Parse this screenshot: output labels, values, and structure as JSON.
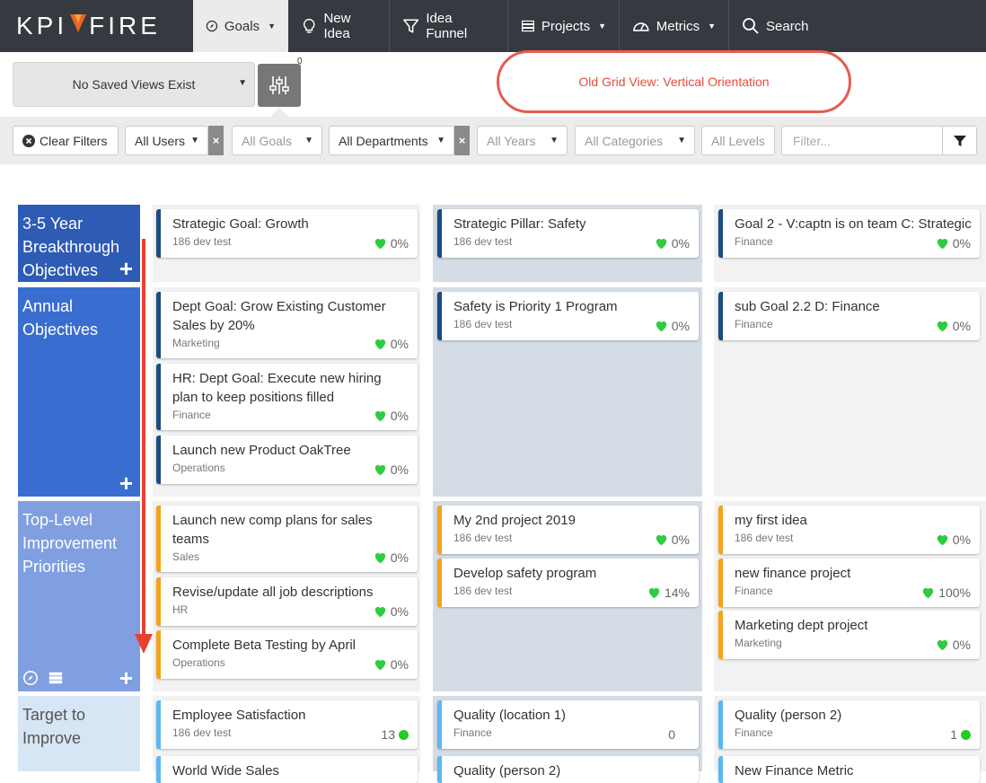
{
  "nav": {
    "logo_left": "KPI",
    "logo_right": "FIRE",
    "items": [
      {
        "label": "Goals",
        "icon": "compass-icon",
        "active": true,
        "dropdown": true
      },
      {
        "label": "New Idea",
        "icon": "lightbulb-icon",
        "active": false,
        "dropdown": false
      },
      {
        "label": "Idea Funnel",
        "icon": "funnel-icon",
        "active": false,
        "dropdown": false
      },
      {
        "label": "Projects",
        "icon": "server-icon",
        "active": false,
        "dropdown": true
      },
      {
        "label": "Metrics",
        "icon": "gauge-icon",
        "active": false,
        "dropdown": true
      },
      {
        "label": "Search",
        "icon": "search-icon",
        "active": false,
        "dropdown": false
      }
    ]
  },
  "toolbar": {
    "saved_views": "No Saved Views Exist",
    "settings_count": "0",
    "annotation": "Old Grid View:  Vertical Orientation"
  },
  "filters": {
    "clear": "Clear Filters",
    "users": "All Users",
    "goals": "All Goals",
    "departments": "All Departments",
    "years": "All Years",
    "categories": "All Categories",
    "levels": "All Levels",
    "filter_placeholder": "Filter..."
  },
  "rows": [
    {
      "label": "3-5 Year Breakthrough Objectives",
      "color": "#2e5bb4"
    },
    {
      "label": "Annual Objectives",
      "color": "#3a6dd0"
    },
    {
      "label": "Top-Level Improvement Priorities",
      "color": "#7f9fe0"
    },
    {
      "label": "Target to Improve",
      "color": "#d6e6f5"
    }
  ],
  "cards": {
    "r0c0": [
      {
        "title": "Strategic Goal: Growth",
        "sub": "186 dev test",
        "metric": "0%"
      }
    ],
    "r0c1": [
      {
        "title": "Strategic Pillar: Safety",
        "sub": "186 dev test",
        "metric": "0%"
      }
    ],
    "r0c2": [
      {
        "title": "Goal 2 - V:captn is on team C: Strategic",
        "sub": "Finance",
        "metric": "0%"
      }
    ],
    "r1c0": [
      {
        "title": "Dept Goal: Grow Existing Customer Sales by 20%",
        "sub": "Marketing",
        "metric": "0%"
      },
      {
        "title": "HR: Dept Goal: Execute new hiring plan to keep positions filled",
        "sub": "Finance",
        "metric": "0%"
      },
      {
        "title": "Launch new Product OakTree",
        "sub": "Operations",
        "metric": "0%"
      }
    ],
    "r1c1": [
      {
        "title": "Safety is Priority 1 Program",
        "sub": "186 dev test",
        "metric": "0%"
      }
    ],
    "r1c2": [
      {
        "title": "sub Goal 2.2 D: Finance",
        "sub": "Finance",
        "metric": "0%"
      }
    ],
    "r2c0": [
      {
        "title": "Launch new comp plans for sales teams",
        "sub": "Sales",
        "metric": "0%"
      },
      {
        "title": "Revise/update all job descriptions",
        "sub": "HR",
        "metric": "0%"
      },
      {
        "title": "Complete Beta Testing by April",
        "sub": "Operations",
        "metric": "0%"
      }
    ],
    "r2c1": [
      {
        "title": "My 2nd project 2019",
        "sub": "186 dev test",
        "metric": "0%"
      },
      {
        "title": "Develop safety program",
        "sub": "186 dev test",
        "metric": "14%"
      }
    ],
    "r2c2": [
      {
        "title": "my first idea",
        "sub": "186 dev test",
        "metric": "0%"
      },
      {
        "title": "new finance project",
        "sub": "Finance",
        "metric": "100%"
      },
      {
        "title": "Marketing dept project",
        "sub": "Marketing",
        "metric": "0%"
      }
    ],
    "r3c0": [
      {
        "title": "Employee Satisfaction",
        "sub": "186 dev test",
        "metric": "13"
      },
      {
        "title": "World Wide Sales",
        "sub": "",
        "metric": ""
      }
    ],
    "r3c1": [
      {
        "title": "Quality (location 1)",
        "sub": "Finance",
        "metric": "0"
      },
      {
        "title": "Quality (person 2)",
        "sub": "",
        "metric": ""
      }
    ],
    "r3c2": [
      {
        "title": "Quality (person 2)",
        "sub": "Finance",
        "metric": "1"
      },
      {
        "title": "New Finance Metric",
        "sub": "",
        "metric": ""
      }
    ]
  },
  "colors": {
    "goal_bar": "#1a4d80",
    "project_bar": "#f5a31a",
    "metric_bar": "#5bb8f0",
    "heart": "#2ecc40"
  }
}
